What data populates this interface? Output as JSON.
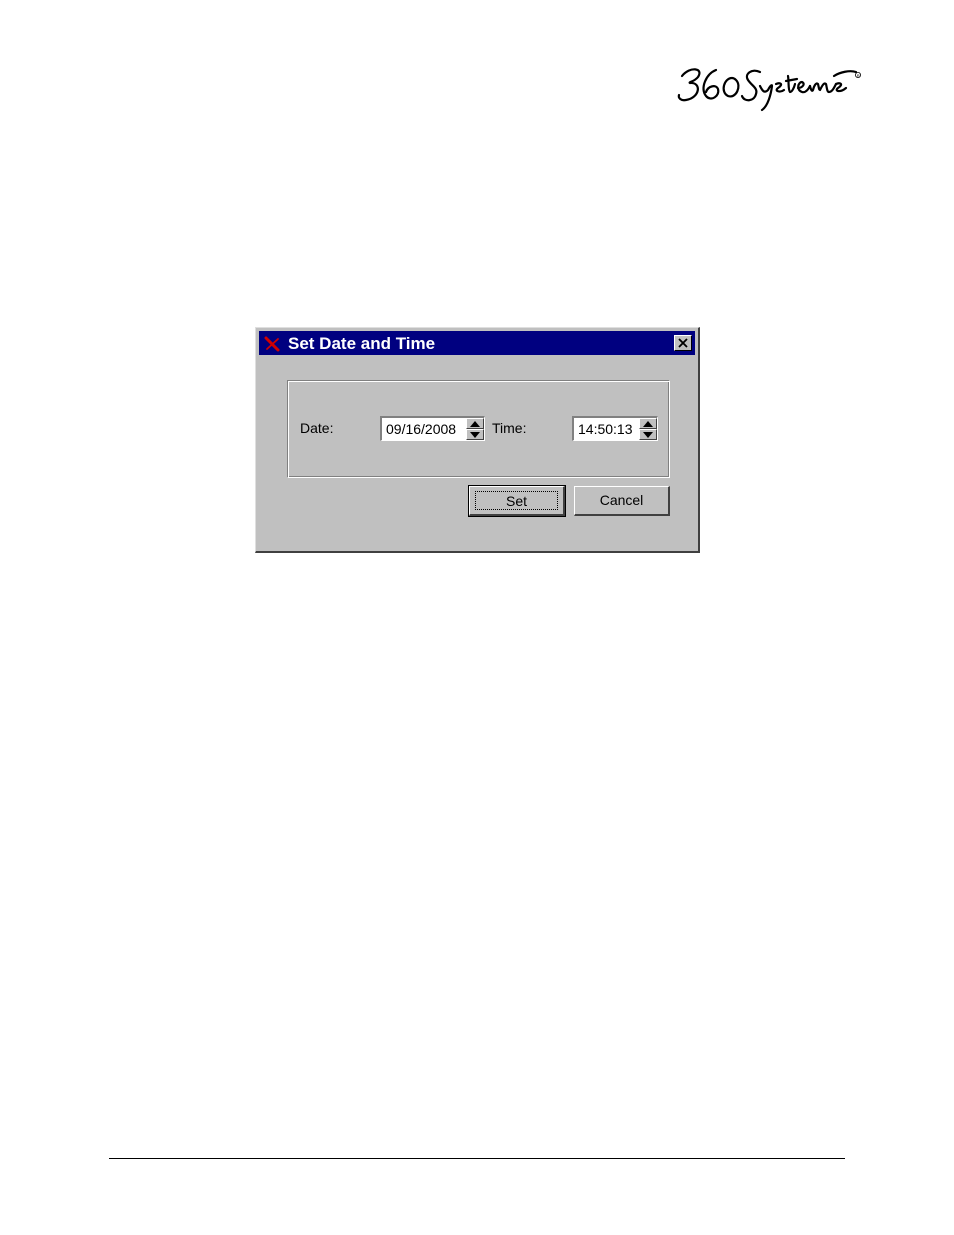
{
  "logo": {
    "name": "360 Systems",
    "icon": "360-systems-logo"
  },
  "dialog": {
    "title": "Set Date and Time",
    "app_icon": "red-x-icon",
    "close_icon": "close-icon",
    "date": {
      "label": "Date:",
      "value": "09/16/2008"
    },
    "time": {
      "label": "Time:",
      "value": "14:50:13"
    },
    "buttons": {
      "set": "Set",
      "cancel": "Cancel"
    }
  },
  "colors": {
    "titlebar": "#000080",
    "dialog_face": "#c0c0c0",
    "app_icon": "#d00000"
  }
}
